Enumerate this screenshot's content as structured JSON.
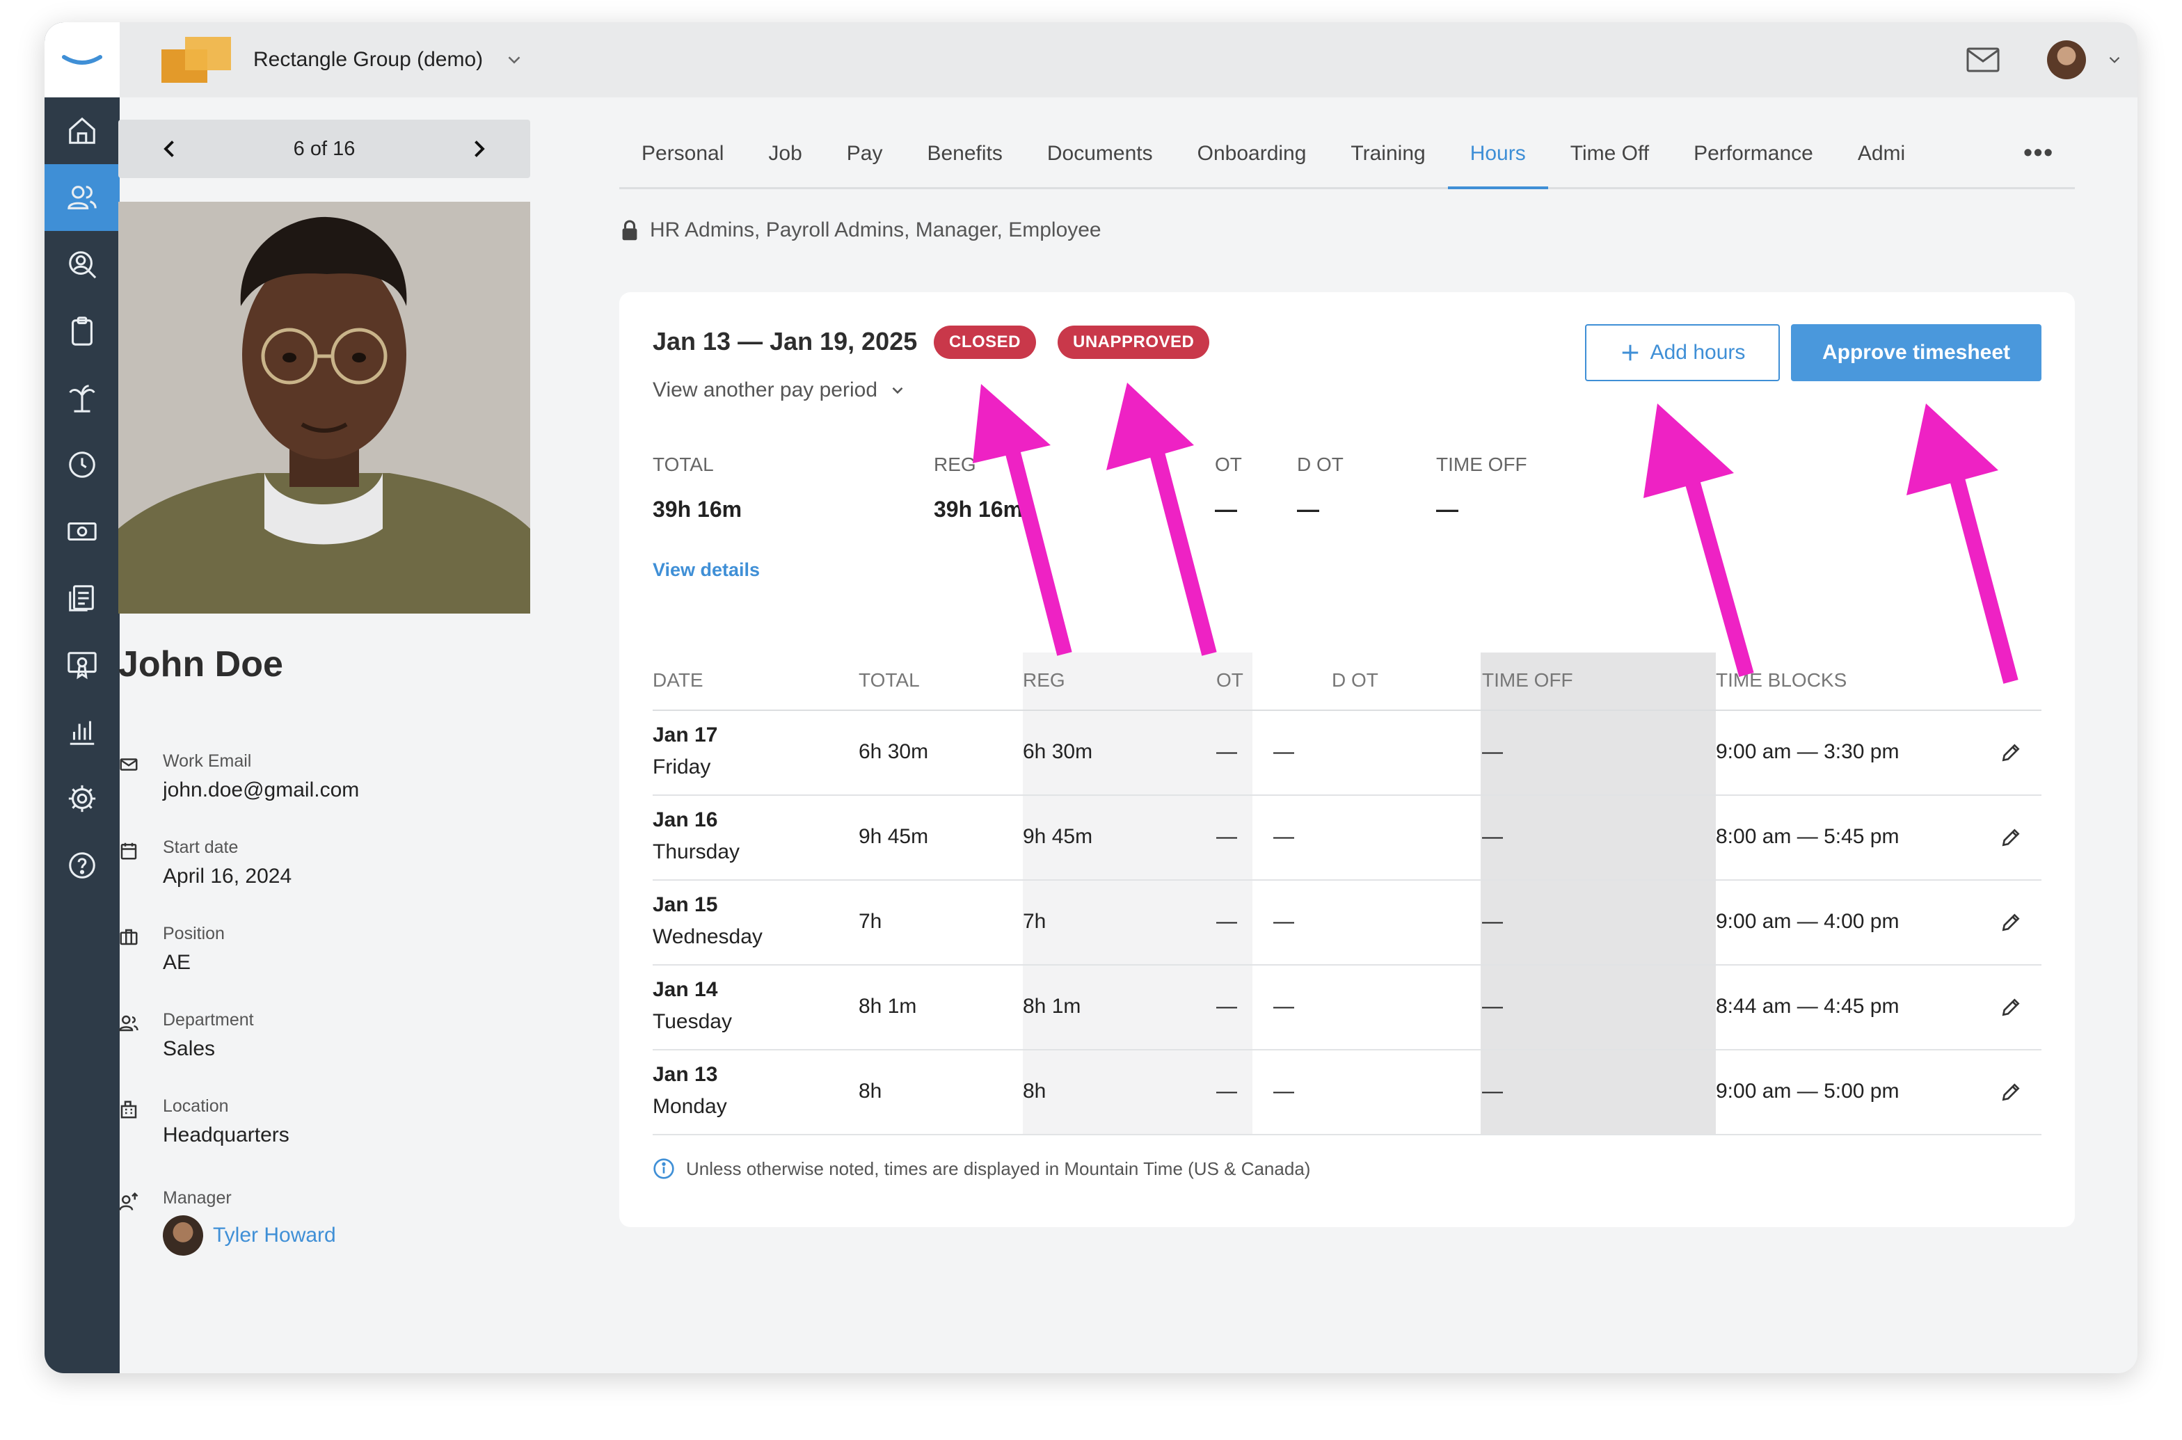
{
  "org": {
    "name": "Rectangle Group (demo)"
  },
  "pager": {
    "text": "6 of 16"
  },
  "employee": {
    "name": "John Doe",
    "fields": [
      {
        "label": "Work Email",
        "value": "john.doe@gmail.com",
        "icon": "mail-icon"
      },
      {
        "label": "Start date",
        "value": "April 16, 2024",
        "icon": "calendar-icon"
      },
      {
        "label": "Position",
        "value": "AE",
        "icon": "briefcase-icon"
      },
      {
        "label": "Department",
        "value": "Sales",
        "icon": "people-icon"
      },
      {
        "label": "Location",
        "value": "Headquarters",
        "icon": "building-icon"
      }
    ],
    "manager": {
      "label": "Manager",
      "name": "Tyler Howard"
    }
  },
  "tabs": [
    "Personal",
    "Job",
    "Pay",
    "Benefits",
    "Documents",
    "Onboarding",
    "Training",
    "Hours",
    "Time Off",
    "Performance",
    "Admi"
  ],
  "active_tab": "Hours",
  "tab_more": "•••",
  "access_text": "HR Admins, Payroll Admins, Manager, Employee",
  "timesheet": {
    "period": "Jan 13 — Jan 19, 2025",
    "badges": [
      "CLOSED",
      "UNAPPROVED"
    ],
    "badge_color": "#c9384a",
    "view_other": "View another pay period",
    "add_hours": "Add hours",
    "approve": "Approve timesheet",
    "summary": [
      {
        "label": "TOTAL",
        "value": "39h 16m"
      },
      {
        "label": "REG",
        "value": "39h 16m"
      },
      {
        "label": "OT",
        "value": "—"
      },
      {
        "label": "D OT",
        "value": "—"
      },
      {
        "label": "TIME OFF",
        "value": "—"
      }
    ],
    "view_details": "View details",
    "columns": [
      "DATE",
      "TOTAL",
      "REG",
      "OT",
      "D OT",
      "TIME OFF",
      "TIME BLOCKS"
    ],
    "rows": [
      {
        "day": "Jan 17",
        "weekday": "Friday",
        "total": "6h 30m",
        "reg": "6h 30m",
        "ot": "—",
        "dot": "—",
        "timeoff": "—",
        "blocks": "9:00 am — 3:30 pm"
      },
      {
        "day": "Jan 16",
        "weekday": "Thursday",
        "total": "9h 45m",
        "reg": "9h 45m",
        "ot": "—",
        "dot": "—",
        "timeoff": "—",
        "blocks": "8:00 am — 5:45 pm"
      },
      {
        "day": "Jan 15",
        "weekday": "Wednesday",
        "total": "7h",
        "reg": "7h",
        "ot": "—",
        "dot": "—",
        "timeoff": "—",
        "blocks": "9:00 am — 4:00 pm"
      },
      {
        "day": "Jan 14",
        "weekday": "Tuesday",
        "total": "8h 1m",
        "reg": "8h 1m",
        "ot": "—",
        "dot": "—",
        "timeoff": "—",
        "blocks": "8:44 am — 4:45 pm"
      },
      {
        "day": "Jan 13",
        "weekday": "Monday",
        "total": "8h",
        "reg": "8h",
        "ot": "—",
        "dot": "—",
        "timeoff": "—",
        "blocks": "9:00 am — 5:00 pm"
      }
    ],
    "note": "Unless otherwise noted, times are displayed in Mountain Time (US & Canada)"
  },
  "colors": {
    "accent": "#3f8fd6",
    "rail": "#2e3b48",
    "annotation": "#ee22c4"
  }
}
